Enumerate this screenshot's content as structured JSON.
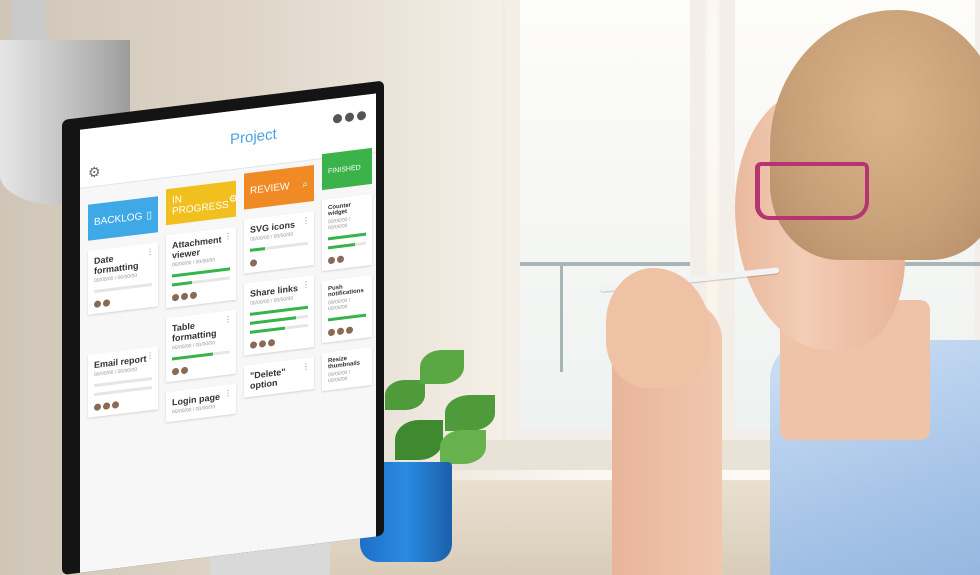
{
  "board": {
    "title": "Project",
    "columns": [
      {
        "label": "BACKLOG",
        "color": "#3fa9e8",
        "cards": [
          {
            "title": "Date formatting",
            "date": "00/00/00 / 00/00/00"
          },
          {
            "title": "Email report",
            "date": "00/00/00 / 00/00/00"
          }
        ]
      },
      {
        "label": "IN PROGRESS",
        "color": "#f2c01e",
        "cards": [
          {
            "title": "Attachment viewer",
            "date": "00/00/00 / 00/00/00"
          },
          {
            "title": "Table formatting",
            "date": "00/00/00 / 00/00/00"
          },
          {
            "title": "Login page",
            "date": "00/00/00 / 00/00/00"
          }
        ]
      },
      {
        "label": "REVIEW",
        "color": "#f08a24",
        "cards": [
          {
            "title": "SVG icons",
            "date": "00/00/00 / 00/00/00"
          },
          {
            "title": "Share links",
            "date": "00/00/00 / 00/00/00"
          },
          {
            "title": "\"Delete\" option",
            "date": ""
          }
        ]
      },
      {
        "label": "FINISHED",
        "color": "#3bb34a",
        "cards": [
          {
            "title": "Counter widget",
            "date": "00/00/00 / 00/00/00"
          },
          {
            "title": "Push notifications",
            "date": "00/00/00 / 00/00/00"
          },
          {
            "title": "Resize thumbnails",
            "date": "00/00/00 / 00/00/00"
          }
        ]
      }
    ]
  },
  "colors": {
    "progress": "#35b44a",
    "pot": "#2a8be0",
    "glasses": "#b4356f",
    "shirt": "#a8c5e8"
  }
}
